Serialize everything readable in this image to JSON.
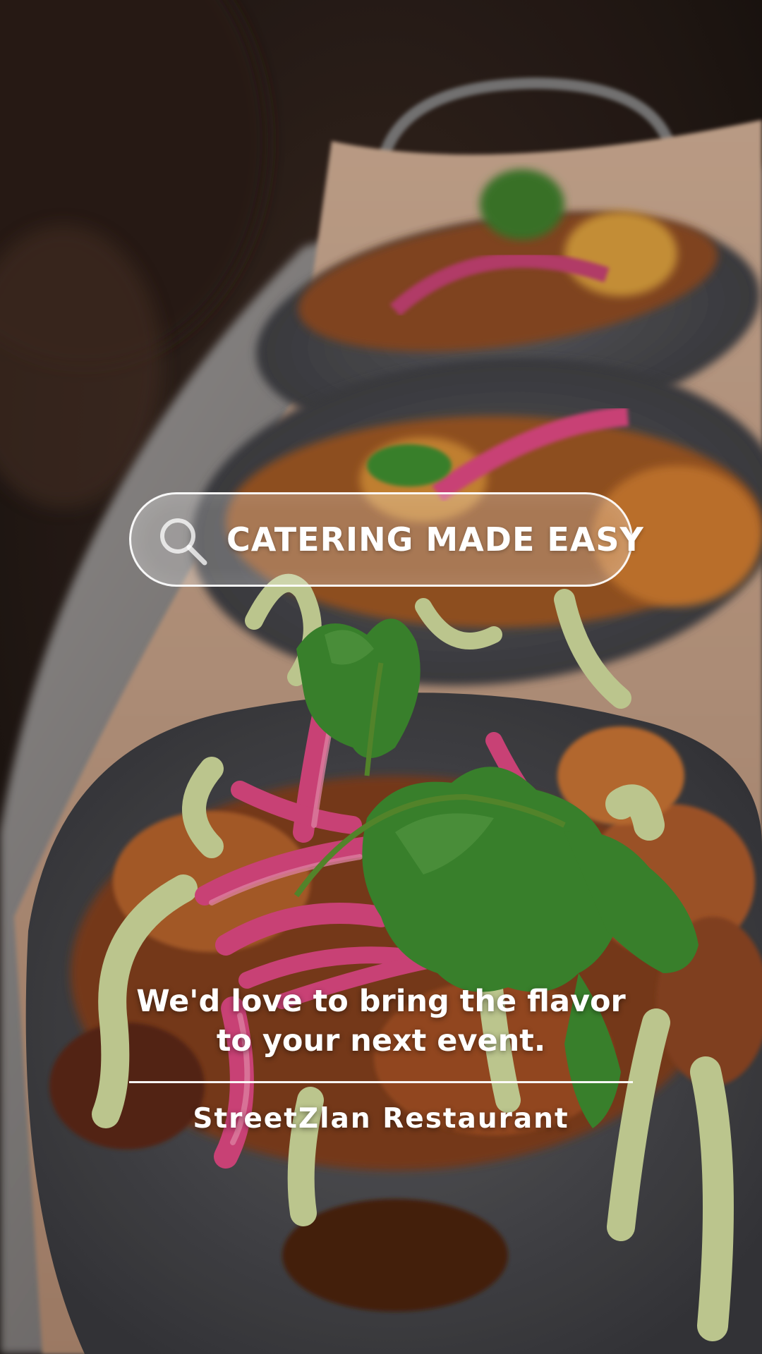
{
  "search": {
    "text": "CATERING MADE EASY",
    "icon": "search-icon"
  },
  "tagline": {
    "line1": "We'd love to bring the flavor",
    "line2": "to your next event."
  },
  "brand": {
    "name": "StreetZlan Restaurant"
  },
  "colors": {
    "text": "#ffffff",
    "tortilla": "#4a4a4e",
    "onion": "#d9477f",
    "cilantro": "#3d8a2f",
    "sauce": "#cbd69a"
  }
}
